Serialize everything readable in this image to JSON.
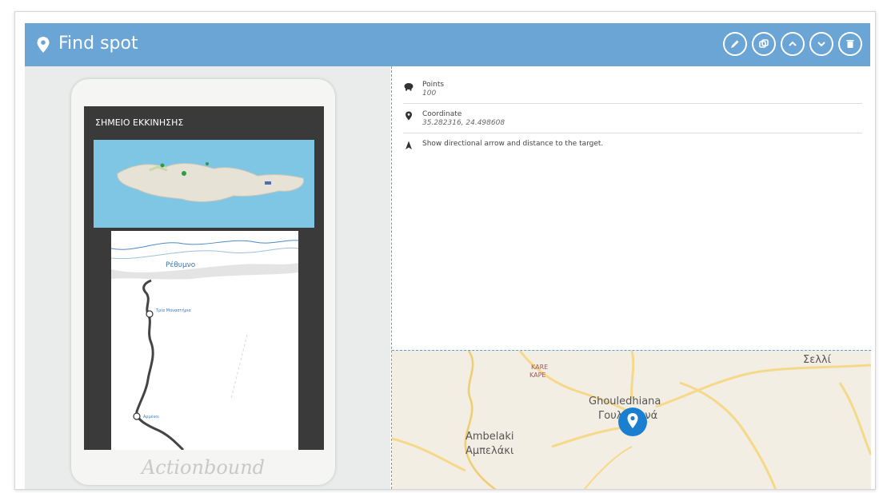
{
  "header": {
    "title": "Find spot",
    "background": "#6aa5d6",
    "tools": [
      "edit-icon",
      "duplicate-icon",
      "move-up-icon",
      "move-down-icon",
      "delete-icon"
    ]
  },
  "preview": {
    "screen_title": "ΣΗΜΕΙΟ ΕΚΚΙΝΗΣΗΣ",
    "map_city_label": "Ρέθυμνο",
    "map_stop_1": "Τρία Μοναστήρια",
    "map_stop_2": "Αρμένοι",
    "brand": "Actionbound"
  },
  "info": {
    "points_label": "Points",
    "points_value": "100",
    "coordinate_label": "Coordinate",
    "coordinate_value": "35.282316, 24.498608",
    "arrow_text": "Show directional arrow and distance to the target."
  },
  "map": {
    "labels": {
      "kare": "KARE",
      "kape": "KAPE",
      "selli": "Σελλί",
      "ghouledhiana": "Ghouledhiana",
      "ghouledhiana_gr": "Γουλεδιανά",
      "ambelaki": "Ambelaki",
      "ambelaki_gr": "Αμπελάκι"
    },
    "marker_color": "#1a7fd0"
  }
}
